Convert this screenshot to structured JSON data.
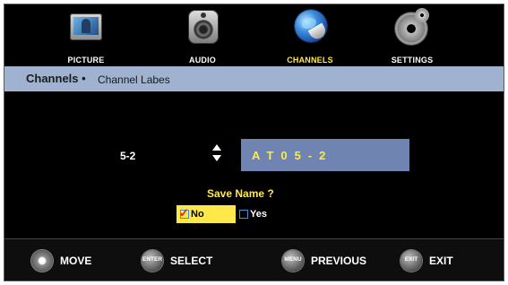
{
  "tabs": [
    {
      "label": "PICTURE",
      "icon": "picture-icon",
      "active": false
    },
    {
      "label": "AUDIO",
      "icon": "speaker-icon",
      "active": false
    },
    {
      "label": "CHANNELS",
      "icon": "globe-icon",
      "active": true
    },
    {
      "label": "SETTINGS",
      "icon": "gear-icon",
      "active": false
    }
  ],
  "breadcrumb": {
    "main": "Channels •",
    "sub": "Channel Labes"
  },
  "channel": {
    "number": "5-2",
    "name": "AT05-2"
  },
  "save": {
    "prompt": "Save Name ?",
    "no_label": "No",
    "yes_label": "Yes",
    "selected": "No"
  },
  "nav": [
    {
      "icon": "dpad-icon",
      "label": "MOVE"
    },
    {
      "icon": "enter-button-icon",
      "button": "ENTER",
      "label": "SELECT"
    },
    {
      "icon": "menu-button-icon",
      "button": "MENU",
      "label": "PREVIOUS"
    },
    {
      "icon": "exit-button-icon",
      "button": "EXIT",
      "label": "EXIT"
    }
  ],
  "colors": {
    "accent": "#ffe84a",
    "breadcrumb_bg": "#9fb2d0",
    "name_box": "#6f84b0",
    "background": "#000000"
  }
}
